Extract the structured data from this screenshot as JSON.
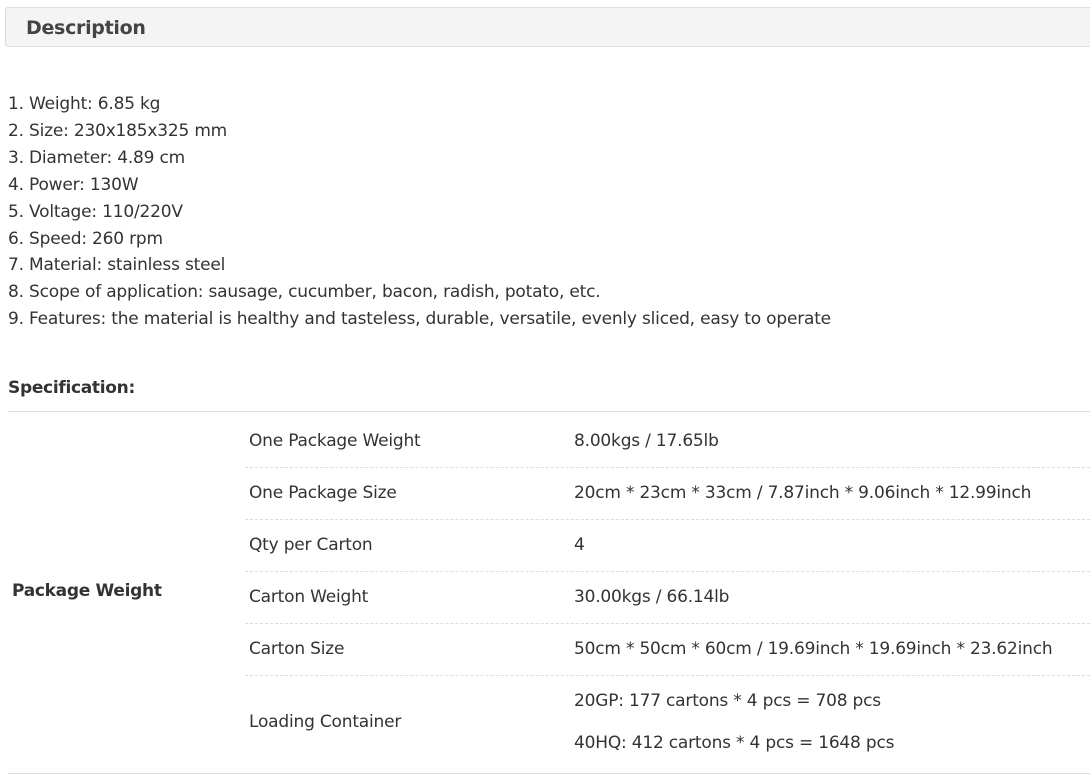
{
  "description": {
    "title": "Description",
    "features": [
      "1. Weight: 6.85 kg",
      "2. Size: 230x185x325 mm",
      "3. Diameter: 4.89 cm",
      "4. Power: 130W",
      "5. Voltage: 110/220V",
      "6. Speed: 260 rpm",
      "7. Material: stainless steel",
      "8. Scope of application: sausage, cucumber, bacon, radish, potato, etc.",
      "9. Features: the material is healthy and tasteless, durable, versatile, evenly sliced, easy to operate"
    ]
  },
  "specification": {
    "heading": "Specification:",
    "group_label": "Package Weight",
    "rows": [
      {
        "key": "One Package Weight",
        "values": [
          "8.00kgs / 17.65lb"
        ]
      },
      {
        "key": "One Package Size",
        "values": [
          "20cm * 23cm * 33cm / 7.87inch * 9.06inch * 12.99inch"
        ]
      },
      {
        "key": "Qty per Carton",
        "values": [
          "4"
        ]
      },
      {
        "key": "Carton Weight",
        "values": [
          "30.00kgs / 66.14lb"
        ]
      },
      {
        "key": "Carton Size",
        "values": [
          "50cm * 50cm * 60cm / 19.69inch * 19.69inch * 23.62inch"
        ]
      },
      {
        "key": "Loading Container",
        "values": [
          "20GP: 177 cartons * 4 pcs = 708 pcs",
          "40HQ: 412 cartons * 4 pcs = 1648 pcs"
        ]
      }
    ]
  }
}
